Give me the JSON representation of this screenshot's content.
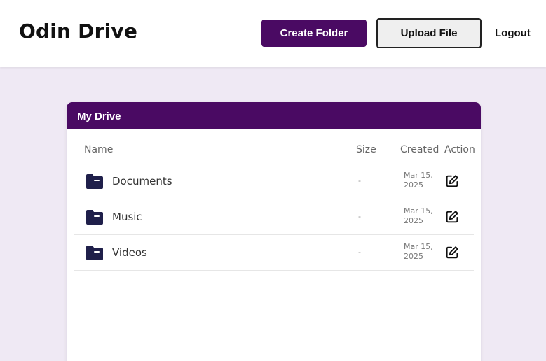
{
  "header": {
    "brand": "Odin Drive",
    "create_folder_label": "Create Folder",
    "upload_file_label": "Upload File",
    "logout_label": "Logout"
  },
  "drive": {
    "title": "My Drive",
    "columns": {
      "name": "Name",
      "size": "Size",
      "created": "Created",
      "action": "Action"
    },
    "rows": [
      {
        "name": "Documents",
        "size": "-",
        "created": "Mar 15, 2025",
        "icon": "folder-icon",
        "action_icon": "edit-icon"
      },
      {
        "name": "Music",
        "size": "-",
        "created": "Mar 15, 2025",
        "icon": "folder-icon",
        "action_icon": "edit-icon"
      },
      {
        "name": "Videos",
        "size": "-",
        "created": "Mar 15, 2025",
        "icon": "folder-icon",
        "action_icon": "edit-icon"
      }
    ]
  },
  "colors": {
    "accent": "#4a0a63",
    "page_background": "#efe9f4",
    "folder_icon": "#1f1f4a"
  }
}
